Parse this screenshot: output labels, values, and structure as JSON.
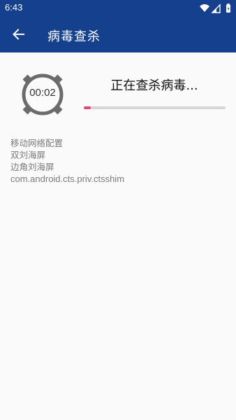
{
  "status_bar": {
    "time": "6:43",
    "icons": [
      "wifi-icon",
      "signal-icon",
      "battery-icon"
    ]
  },
  "app_bar": {
    "back_icon": "arrow-left-icon",
    "title": "病毒查杀",
    "color": "#14408d"
  },
  "scan": {
    "timer": "00:02",
    "status": "正在查杀病毒...",
    "progress": 0.05,
    "progress_color": "#e0457b"
  },
  "log": [
    "移动网络配置",
    "双刘海屏",
    "边角刘海屏",
    "com.android.cts.priv.ctsshim"
  ]
}
